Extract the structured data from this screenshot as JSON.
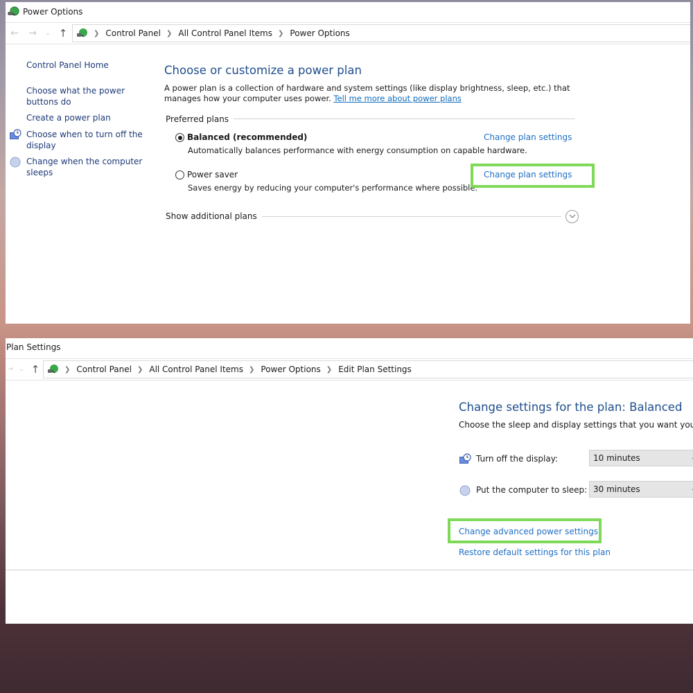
{
  "colors": {
    "accent_link": "#1f6ec4",
    "heading_blue": "#1e4e8c",
    "sidebar_link": "#1e3a78",
    "highlight_green": "#7ed957"
  },
  "top_window": {
    "title": "Power Options",
    "app_icon": "power-plug-icon",
    "nav": {
      "back_icon": "arrow-left-icon",
      "forward_icon": "arrow-right-icon",
      "recent_icon": "chevron-down-icon",
      "up_icon": "arrow-up-icon"
    },
    "breadcrumbs": [
      "Control Panel",
      "All Control Panel Items",
      "Power Options"
    ],
    "sidebar": {
      "home": "Control Panel Home",
      "items": [
        {
          "label": "Choose what the power buttons do",
          "icon": null
        },
        {
          "label": "Create a power plan",
          "icon": null
        },
        {
          "label": "Choose when to turn off the display",
          "icon": "display-clock-icon"
        },
        {
          "label": "Change when the computer sleeps",
          "icon": "moon-sleep-icon"
        }
      ]
    },
    "main": {
      "title": "Choose or customize a power plan",
      "description": "A power plan is a collection of hardware and system settings (like display brightness, sleep, etc.) that manages how your computer uses power.",
      "learn_more_link": "Tell me more about power plans",
      "preferred_plans_label": "Preferred plans",
      "plans": [
        {
          "name": "Balanced (recommended)",
          "selected": true,
          "description": "Automatically balances performance with energy consumption on capable hardware.",
          "change_link": "Change plan settings",
          "highlighted": false
        },
        {
          "name": "Power saver",
          "selected": false,
          "description": "Saves energy by reducing your computer's performance where possible.",
          "change_link": "Change plan settings",
          "highlighted": true
        }
      ],
      "show_additional_label": "Show additional plans",
      "expand_icon": "chevron-down-circle-icon"
    }
  },
  "bottom_window": {
    "title": "Plan Settings",
    "breadcrumbs": [
      "Control Panel",
      "All Control Panel Items",
      "Power Options",
      "Edit Plan Settings"
    ],
    "heading": "Change settings for the plan: Balanced",
    "subheading": "Choose the sleep and display settings that you want your com",
    "settings": [
      {
        "label": "Turn off the display:",
        "value": "10 minutes",
        "icon": "display-clock-icon"
      },
      {
        "label": "Put the computer to sleep:",
        "value": "30 minutes",
        "icon": "moon-sleep-icon"
      }
    ],
    "advanced_link": "Change advanced power settings",
    "advanced_highlighted": true,
    "restore_link": "Restore default settings for this plan"
  }
}
